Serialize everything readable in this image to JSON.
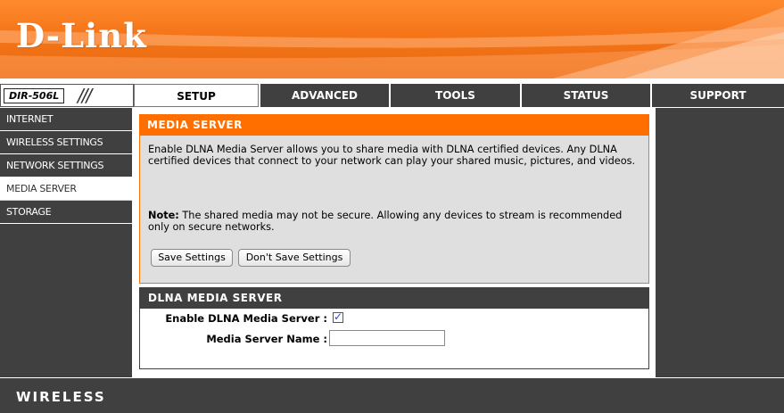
{
  "brand": {
    "logo_text": "D-Link",
    "model": "DIR-506L",
    "model_slashes": "///",
    "accent_color": "#ff6f00",
    "dark_color": "#404040"
  },
  "tabs": [
    {
      "label": "SETUP",
      "active": true
    },
    {
      "label": "ADVANCED",
      "active": false
    },
    {
      "label": "TOOLS",
      "active": false
    },
    {
      "label": "STATUS",
      "active": false
    },
    {
      "label": "SUPPORT",
      "active": false
    }
  ],
  "sidebar": {
    "items": [
      {
        "label": "INTERNET",
        "active": false
      },
      {
        "label": "WIRELESS SETTINGS",
        "active": false
      },
      {
        "label": "NETWORK SETTINGS",
        "active": false
      },
      {
        "label": "MEDIA SERVER",
        "active": true
      },
      {
        "label": "STORAGE",
        "active": false
      }
    ]
  },
  "media_server": {
    "title": "MEDIA SERVER",
    "description": "Enable DLNA Media Server allows you to share media with DLNA certified devices. Any DLNA certified devices that connect to your network can play your shared music, pictures, and videos.",
    "note_label": "Note:",
    "note_text": " The shared media may not be secure. Allowing any devices to stream is recommended only on secure networks.",
    "save_label": "Save Settings",
    "dont_save_label": "Don't Save Settings"
  },
  "dlna": {
    "title": "DLNA MEDIA SERVER",
    "enable_label": "Enable DLNA Media Server :",
    "enable_checked": true,
    "checkmark": "✓",
    "name_label": "Media Server Name :",
    "name_value": ""
  },
  "footer": {
    "label": "WIRELESS"
  }
}
